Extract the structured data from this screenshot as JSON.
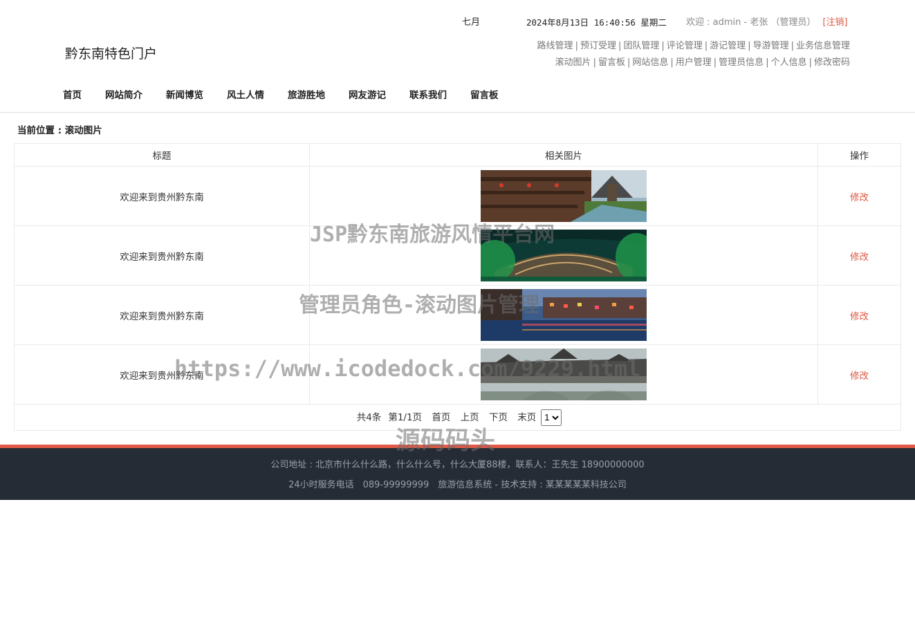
{
  "header": {
    "site_title": "黔东南特色门户",
    "marquee_fragment": "七月",
    "datetime": "2024年8月13日 16:40:56 星期二",
    "welcome_text": "欢迎 : admin - 老张 （管理员）",
    "logout_label": "[注销]",
    "admin_links_row1": [
      "路线管理",
      "预订受理",
      "团队管理",
      "评论管理",
      "游记管理",
      "导游管理",
      "业务信息管理"
    ],
    "admin_links_row2": [
      "滚动图片",
      "留言板",
      "网站信息",
      "用户管理",
      "管理员信息",
      "个人信息",
      "修改密码"
    ]
  },
  "nav": [
    "首页",
    "网站简介",
    "新闻博览",
    "风土人情",
    "旅游胜地",
    "网友游记",
    "联系我们",
    "留言板"
  ],
  "breadcrumb": "当前位置 : 滚动图片",
  "table": {
    "headers": [
      "标题",
      "相关图片",
      "操作"
    ],
    "rows": [
      {
        "title": "欢迎来到贵州黔东南",
        "image": "drum-tower-river-village",
        "action": "修改"
      },
      {
        "title": "欢迎来到贵州黔东南",
        "image": "terraced-miao-village-green-lights",
        "action": "修改"
      },
      {
        "title": "欢迎来到贵州黔东南",
        "image": "riverside-night-lights",
        "action": "修改"
      },
      {
        "title": "欢迎来到贵州黔东南",
        "image": "wind-rain-bridge",
        "action": "修改"
      }
    ]
  },
  "pager": {
    "total": "共4条",
    "page_info": "第1/1页",
    "first": "首页",
    "prev": "上页",
    "next": "下页",
    "last": "末页",
    "selected_page": "1"
  },
  "footer": {
    "line1": "公司地址 : 北京市什么什么路，什么什么号，什么大厦88楼，联系人：王先生 18900000000",
    "line2": "24小时服务电话　089-99999999　旅游信息系统 - 技术支持 : 某某某某某科技公司"
  },
  "watermarks": [
    "JSP黔东南旅游风情平台网",
    "管理员角色-滚动图片管理",
    "https://www.icodedock.com/9229.html",
    "源码码头"
  ],
  "colors": {
    "accent": "#e05a45",
    "footer_bg": "#262c36",
    "link_gray": "#777777"
  }
}
